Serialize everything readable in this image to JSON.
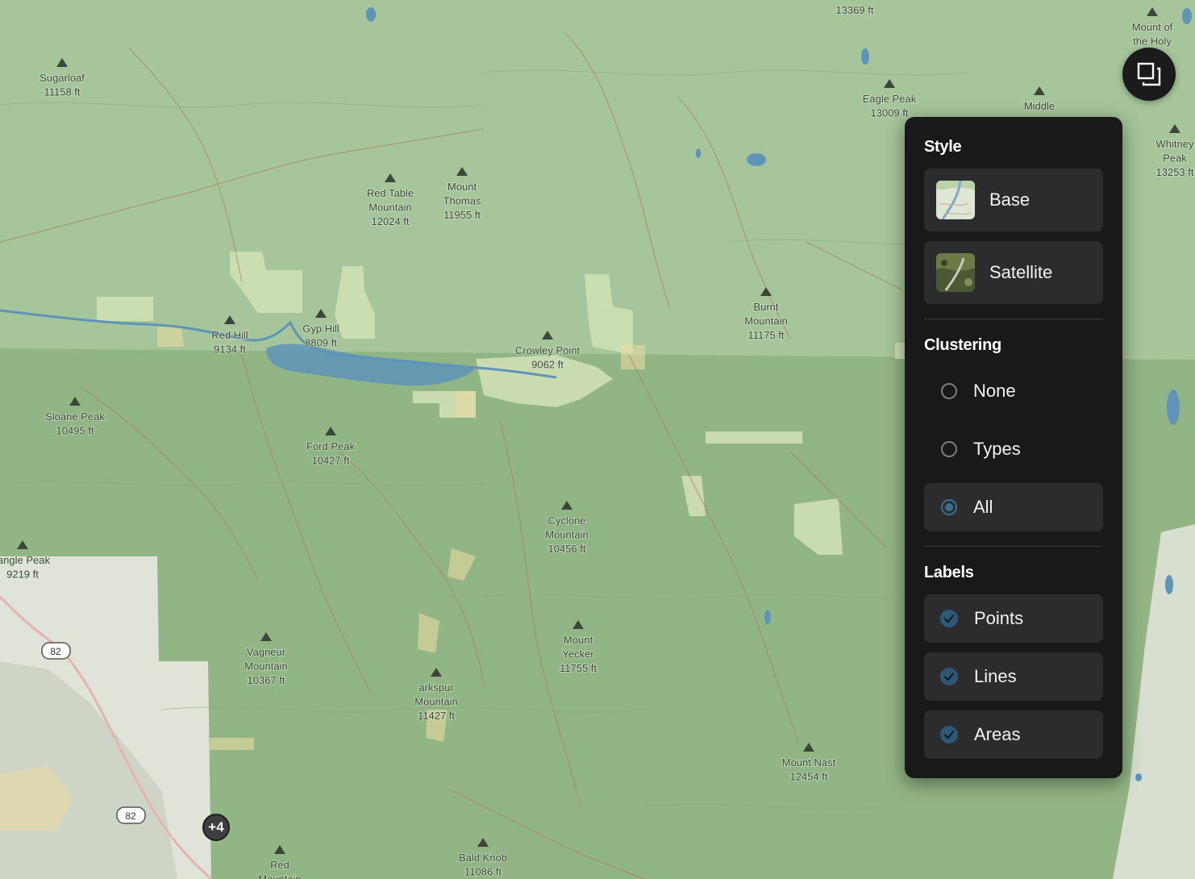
{
  "map": {
    "peaks": [
      {
        "lines": [
          "Sugarloaf",
          "11158 ft"
        ]
      },
      {
        "lines": [
          "Red Table",
          "Mountain",
          "12024 ft"
        ]
      },
      {
        "lines": [
          "Mount",
          "Thomas",
          "11955 ft"
        ]
      },
      {
        "lines": [
          "Eagle Peak",
          "13009 ft"
        ]
      },
      {
        "lines": [
          "Middle"
        ]
      },
      {
        "lines": [
          "13369 ft"
        ]
      },
      {
        "lines": [
          "Mount of",
          "the Holy"
        ]
      },
      {
        "lines": [
          "Whitney",
          "Peak",
          "13253 ft"
        ]
      },
      {
        "lines": [
          "Burnt",
          "Mountain",
          "11175 ft"
        ]
      },
      {
        "lines": [
          "Red Hill",
          "9134 ft"
        ]
      },
      {
        "lines": [
          "Gyp Hill",
          "8809 ft"
        ]
      },
      {
        "lines": [
          "Crowley Point",
          "9062 ft"
        ]
      },
      {
        "lines": [
          "Sloane Peak",
          "10495 ft"
        ]
      },
      {
        "lines": [
          "Ford Peak",
          "10427 ft"
        ]
      },
      {
        "lines": [
          "Cyclone",
          "Mountain",
          "10456 ft"
        ]
      },
      {
        "lines": [
          "iangle Peak",
          "9219 ft"
        ]
      },
      {
        "lines": [
          "Vagneur",
          "Mountain",
          "10367 ft"
        ]
      },
      {
        "lines": [
          "Mount",
          "Yecker",
          "11755 ft"
        ]
      },
      {
        "lines": [
          "arkspur",
          "Mountain",
          "11427 ft"
        ]
      },
      {
        "lines": [
          "Mount Nast",
          "12454 ft"
        ]
      },
      {
        "lines": [
          "Bald Knob",
          "11086 ft"
        ]
      },
      {
        "lines": [
          "Red",
          "Mountain"
        ]
      }
    ],
    "highway_shields": [
      "82",
      "82"
    ],
    "cluster_badge": "+4"
  },
  "layers_button": {
    "icon": "layers-icon"
  },
  "panel": {
    "style": {
      "title": "Style",
      "options": [
        {
          "label": "Base",
          "thumb": "topo-thumbnail"
        },
        {
          "label": "Satellite",
          "thumb": "satellite-thumbnail"
        }
      ]
    },
    "clustering": {
      "title": "Clustering",
      "options": [
        {
          "label": "None",
          "selected": false
        },
        {
          "label": "Types",
          "selected": false
        },
        {
          "label": "All",
          "selected": true
        }
      ]
    },
    "labels": {
      "title": "Labels",
      "options": [
        {
          "label": "Points",
          "checked": true
        },
        {
          "label": "Lines",
          "checked": true
        },
        {
          "label": "Areas",
          "checked": true
        }
      ]
    }
  },
  "colors": {
    "panel_bg": "#19181a",
    "option_bg": "#2c2c2f",
    "accent": "#2c5a76",
    "forest": "#9cbd8f",
    "water": "#5e94b8"
  }
}
